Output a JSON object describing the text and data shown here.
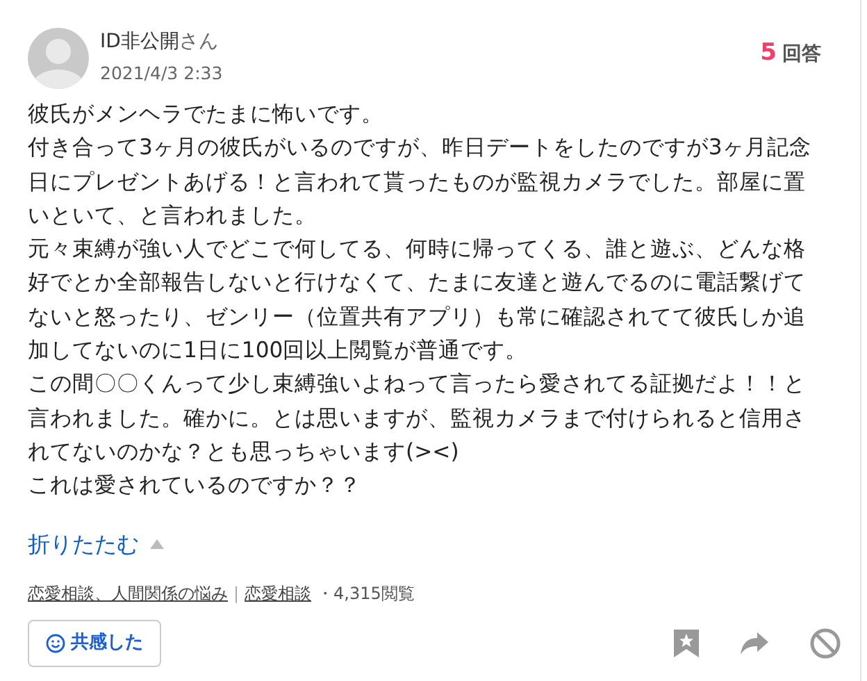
{
  "author": {
    "name": "ID非公開",
    "suffix": "さん",
    "date": "2021/4/3 2:33"
  },
  "answers": {
    "count": "5",
    "label": "回答"
  },
  "body": [
    "彼氏がメンヘラでたまに怖いです。",
    "付き合って3ヶ月の彼氏がいるのですが、昨日デートをしたのですが3ヶ月記念日にプレゼントあげる！と言われて貰ったものが監視カメラでした。部屋に置いといて、と言われました。",
    "元々束縛が強い人でどこで何してる、何時に帰ってくる、誰と遊ぶ、どんな格好でとか全部報告しないと行けなくて、たまに友達と遊んでるのに電話繋げてないと怒ったり、ゼンリー（位置共有アプリ）も常に確認されてて彼氏しか追加してないのに1日に100回以上閲覧が普通です。",
    "この間〇〇くんって少し束縛強いよねって言ったら愛されてる証拠だよ！！と言われました。確かに。とは思いますが、監視カメラまで付けられると信用されてないのかな？とも思っちゃいます(><)",
    "これは愛されているのですか？？"
  ],
  "collapse": {
    "label": "折りたたむ",
    "expanded": true
  },
  "categories": [
    {
      "label": "恋愛相談、人間関係の悩み"
    },
    {
      "label": "恋愛相談"
    }
  ],
  "separator": "|",
  "views": "・4,315閲覧",
  "empathy_button": {
    "label": "共感した"
  }
}
